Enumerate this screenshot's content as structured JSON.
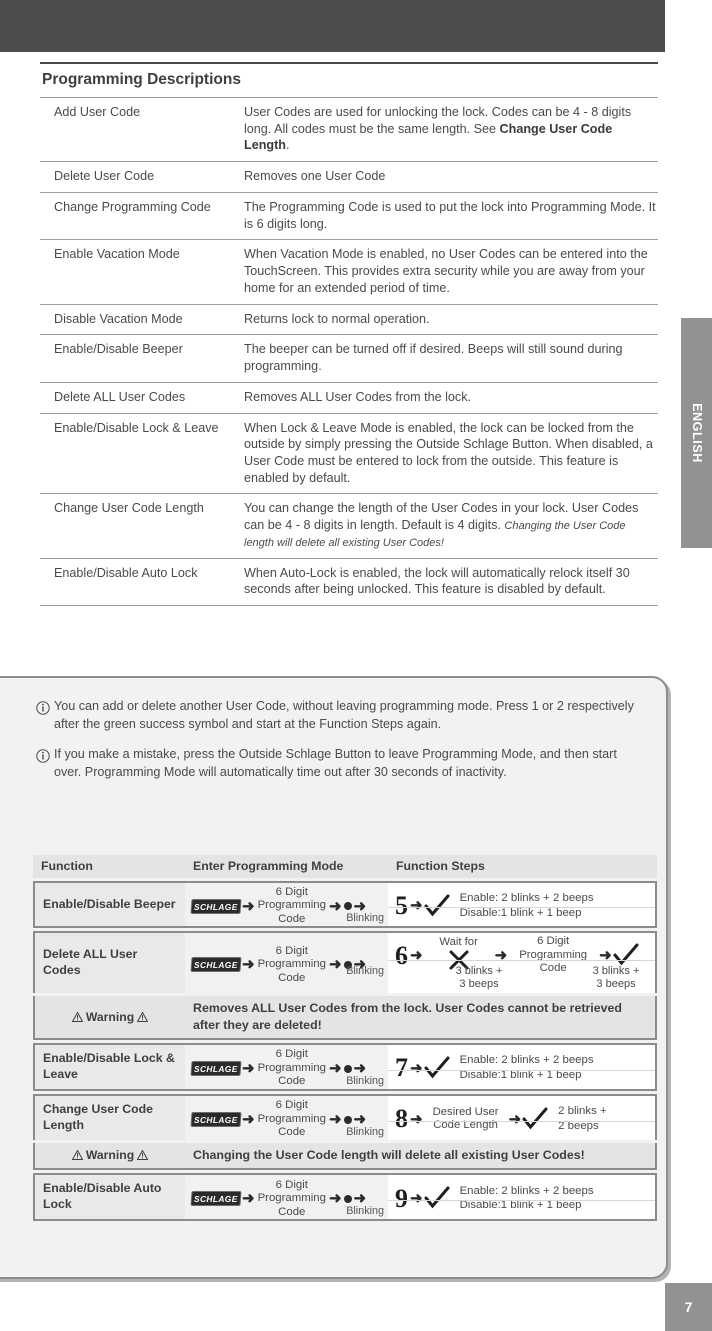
{
  "page": {
    "number": "7",
    "side_tab_label": "ENGLISH"
  },
  "descriptions": {
    "title": "Programming Descriptions",
    "rows": [
      {
        "name": "Add User Code",
        "desc_pre": "User Codes are used for unlocking the lock. Codes can be 4 - 8 digits long. All codes must be the same length. See ",
        "desc_bold": "Change User Code Length",
        "desc_post": "."
      },
      {
        "name": "Delete User Code",
        "desc_pre": "Removes one User Code",
        "desc_bold": "",
        "desc_post": ""
      },
      {
        "name": "Change Programming Code",
        "desc_pre": "The Programming Code is used to put the lock into Programming Mode. It is 6 digits long.",
        "desc_bold": "",
        "desc_post": ""
      },
      {
        "name": "Enable Vacation Mode",
        "desc_pre": "When Vacation Mode is enabled, no User Codes can be entered into the TouchScreen. This provides extra security while you are away from your home for an extended period of time.",
        "desc_bold": "",
        "desc_post": ""
      },
      {
        "name": "Disable Vacation Mode",
        "desc_pre": "Returns lock to normal operation.",
        "desc_bold": "",
        "desc_post": ""
      },
      {
        "name": "Enable/Disable Beeper",
        "desc_pre": "The beeper can be turned off if desired. Beeps will still sound during programming.",
        "desc_bold": "",
        "desc_post": ""
      },
      {
        "name": "Delete ALL User Codes",
        "desc_pre": "Removes ALL User Codes from the lock.",
        "desc_bold": "",
        "desc_post": ""
      },
      {
        "name": "Enable/Disable Lock & Leave",
        "desc_pre": "When Lock & Leave Mode is enabled, the lock can be locked from the outside by simply pressing the Outside Schlage Button. When disabled, a User Code must be entered to lock from the outside. This feature is enabled by default.",
        "desc_bold": "",
        "desc_post": ""
      },
      {
        "name": "Change User Code Length",
        "desc_pre": "You can change the length of the User Codes in your lock. User Codes can be 4 - 8 digits in length. Default is 4 digits. ",
        "desc_italic": "Changing the User Code length will delete all existing User Codes!",
        "desc_bold": "",
        "desc_post": ""
      },
      {
        "name": "Enable/Disable Auto Lock",
        "desc_pre": "When Auto-Lock is enabled, the lock will automatically relock itself 30 seconds after being unlocked. This feature is disabled by default.",
        "desc_bold": "",
        "desc_post": ""
      }
    ]
  },
  "notes": [
    {
      "icon": "info-icon",
      "text": "You can add or delete another User Code, without leaving programming mode. Press 1 or 2 respectively after the green success symbol and start at the Function Steps again."
    },
    {
      "icon": "info-icon",
      "text": "If you make a mistake, press the Outside Schlage Button to leave Programming Mode, and then start over. Programming Mode will automatically time out after 30 seconds of inactivity."
    }
  ],
  "steps_table": {
    "headers": {
      "function": "Function",
      "enter_mode": "Enter Programming Mode",
      "function_steps": "Function Steps"
    },
    "common": {
      "logo_label": "SCHLAGE",
      "code_line1": "6 Digit",
      "code_line2": "Programming",
      "code_line3": "Code",
      "blinking_label": "Blinking",
      "enable_result": "Enable: 2 blinks + 2 beeps",
      "disable_result": "Disable:1 blink + 1 beep"
    },
    "rows": [
      {
        "function": "Enable/Disable Beeper",
        "digit": "5",
        "result_line1": "Enable: 2 blinks + 2 beeps",
        "result_line2": "Disable:1 blink + 1 beep"
      },
      {
        "function": "Delete ALL User Codes",
        "digit": "6",
        "wait_label1": "Wait for",
        "wait_symbol": "x-mark-icon",
        "mid_note1_line1": "3 blinks +",
        "mid_note1_line2": "3 beeps",
        "second_code_line1": "6 Digit",
        "second_code_line2": "Programming",
        "second_code_line3": "Code",
        "end_note_line1": "3 blinks +",
        "end_note_line2": "3 beeps",
        "warning_label": "Warning",
        "warning_text": "Removes ALL User Codes from the lock. User Codes cannot be retrieved after they are deleted!"
      },
      {
        "function": "Enable/Disable Lock & Leave",
        "digit": "7",
        "result_line1": "Enable: 2 blinks + 2 beeps",
        "result_line2": "Disable:1 blink + 1 beep"
      },
      {
        "function": "Change User Code Length",
        "digit": "8",
        "desired_line1": "Desired User",
        "desired_line2": "Code Length",
        "result_line1": "2 blinks +",
        "result_line2": "2 beeps",
        "warning_label": "Warning",
        "warning_text": "Changing the User Code length will delete all existing User Codes!"
      },
      {
        "function": "Enable/Disable Auto Lock",
        "digit": "9",
        "result_line1": "Enable: 2 blinks + 2 beeps",
        "result_line2": "Disable:1 blink + 1 beep"
      }
    ]
  },
  "colors": {
    "dark_bar": "#4d4b4c",
    "tab_gray": "#929292",
    "text": "#4a4a4a",
    "panel_bg": "#f2f2f2",
    "header_row": "#e4e4e4"
  }
}
